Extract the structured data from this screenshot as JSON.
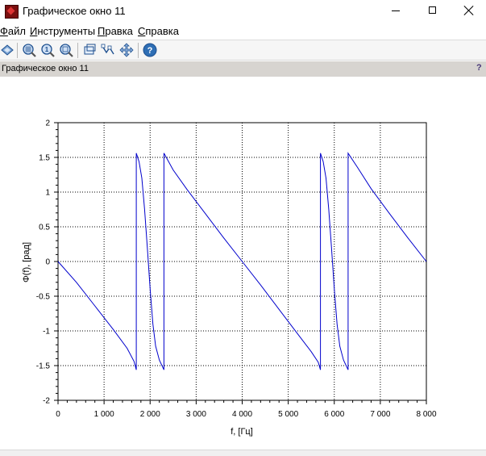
{
  "window": {
    "title": "Графическое окно 11"
  },
  "menu": [
    {
      "accel": "Ф",
      "rest": "айл"
    },
    {
      "accel": "И",
      "rest": "нструменты"
    },
    {
      "accel": "П",
      "rest": "равка"
    },
    {
      "accel": "С",
      "rest": "правка"
    }
  ],
  "toolbar_icons": [
    "rotate-icon",
    "zoom-in-icon",
    "zoom-out-icon",
    "zoom-reset-icon",
    "select-icon",
    "datatip-icon",
    "pan-icon",
    "help-icon"
  ],
  "info": {
    "title": "Графическое окно 11",
    "help": "?"
  },
  "colors": {
    "series": "#0000cc",
    "info_bar": "#d7d4d0"
  },
  "chart_data": {
    "type": "line",
    "xlabel": "f, [Гц]",
    "ylabel": "Φ(f), [рад]",
    "xlim": [
      0,
      8000
    ],
    "ylim": [
      -2,
      2
    ],
    "grid": true,
    "x_ticks": [
      0,
      1000,
      2000,
      3000,
      4000,
      5000,
      6000,
      7000,
      8000
    ],
    "x_tick_labels": [
      "0",
      "1 000",
      "2 000",
      "3 000",
      "4 000",
      "5 000",
      "6 000",
      "7 000",
      "8 000"
    ],
    "y_ticks": [
      -2,
      -1.5,
      -1,
      -0.5,
      0,
      0.5,
      1,
      1.5,
      2
    ],
    "y_tick_labels": [
      "-2",
      "-1.5",
      "-1",
      "-0.5",
      "0",
      "0.5",
      "1",
      "1.5",
      "2"
    ],
    "series": [
      {
        "points": [
          [
            0,
            0
          ],
          [
            400,
            -0.3
          ],
          [
            800,
            -0.64
          ],
          [
            1200,
            -0.98
          ],
          [
            1500,
            -1.25
          ],
          [
            1650,
            -1.44
          ],
          [
            1700,
            -1.56
          ],
          [
            1700,
            1.56
          ],
          [
            1760,
            1.44
          ],
          [
            1820,
            1.2
          ],
          [
            1880,
            0.75
          ],
          [
            1940,
            0.2
          ],
          [
            2000,
            -0.4
          ],
          [
            2060,
            -0.9
          ],
          [
            2120,
            -1.22
          ],
          [
            2200,
            -1.42
          ],
          [
            2300,
            -1.56
          ],
          [
            2300,
            1.56
          ],
          [
            2500,
            1.32
          ],
          [
            2800,
            1.04
          ],
          [
            3200,
            0.69
          ],
          [
            3600,
            0.34
          ],
          [
            4000,
            0
          ],
          [
            4400,
            -0.34
          ],
          [
            4800,
            -0.69
          ],
          [
            5200,
            -1.04
          ],
          [
            5500,
            -1.3
          ],
          [
            5650,
            -1.45
          ],
          [
            5700,
            -1.56
          ],
          [
            5700,
            1.56
          ],
          [
            5760,
            1.44
          ],
          [
            5820,
            1.2
          ],
          [
            5880,
            0.75
          ],
          [
            5940,
            0.2
          ],
          [
            6000,
            -0.4
          ],
          [
            6060,
            -0.9
          ],
          [
            6120,
            -1.22
          ],
          [
            6200,
            -1.42
          ],
          [
            6300,
            -1.56
          ],
          [
            6300,
            1.56
          ],
          [
            6500,
            1.36
          ],
          [
            6800,
            1.05
          ],
          [
            7200,
            0.69
          ],
          [
            7600,
            0.34
          ],
          [
            8000,
            0
          ]
        ]
      }
    ]
  }
}
